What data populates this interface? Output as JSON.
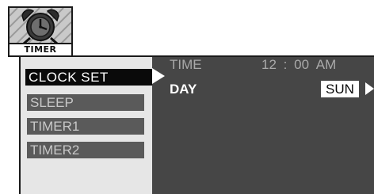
{
  "icon": {
    "name": "timer-clock-icon",
    "label": "TIMER"
  },
  "menu": {
    "items": [
      {
        "label": "CLOCK SET",
        "state": "selected"
      },
      {
        "label": "SLEEP",
        "state": "unselected"
      },
      {
        "label": "TIMER1",
        "state": "unselected"
      },
      {
        "label": "TIMER2",
        "state": "unselected"
      }
    ]
  },
  "settings": {
    "time": {
      "label": "TIME",
      "hour": "12",
      "separator": ":",
      "minute": "00",
      "period": "AM"
    },
    "day": {
      "label": "DAY",
      "value": "SUN"
    }
  },
  "colors": {
    "panel": "#464646",
    "menu_background": "#e6e6e6",
    "selected_item": "#0a0a0a",
    "unselected_item": "#5a5a5a",
    "dim_text": "#a9a9a9"
  }
}
